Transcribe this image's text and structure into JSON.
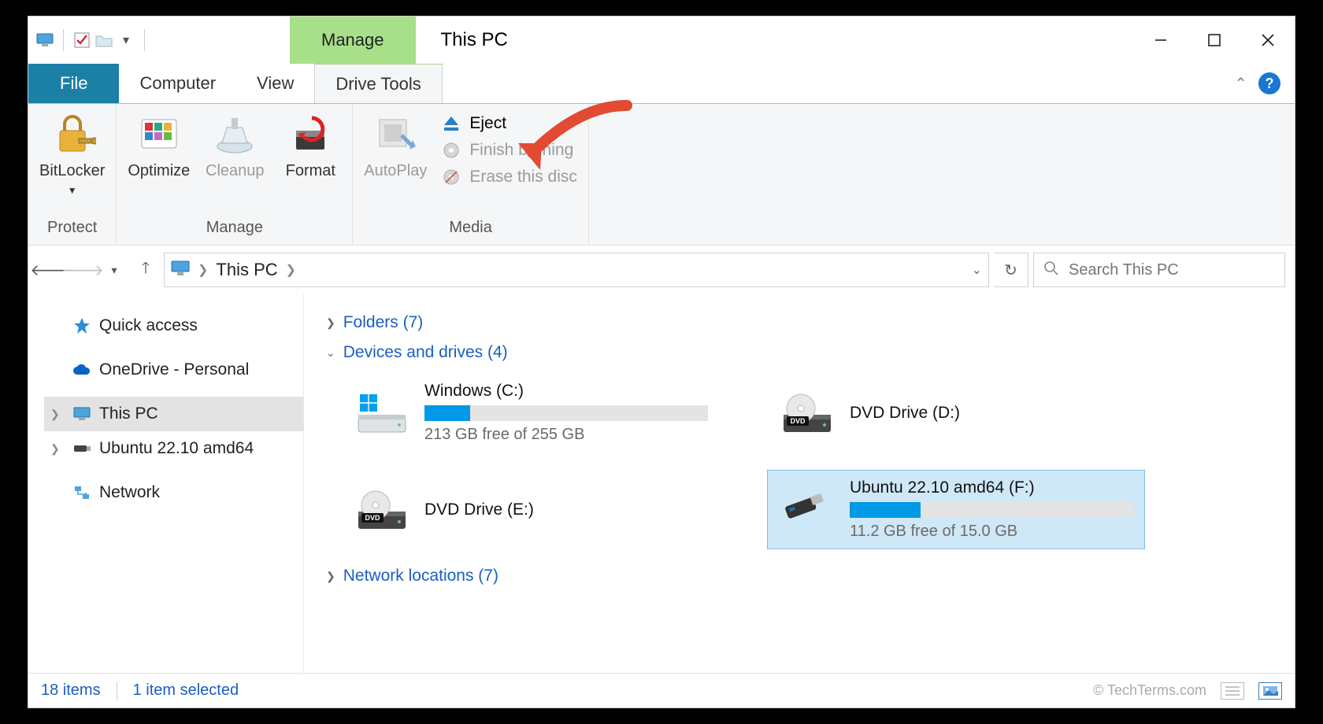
{
  "title": "This PC",
  "context_tab": "Manage",
  "tabs": {
    "file": "File",
    "computer": "Computer",
    "view": "View",
    "drive_tools": "Drive Tools"
  },
  "ribbon": {
    "protect": {
      "bitlocker": "BitLocker",
      "group_label": "Protect"
    },
    "manage": {
      "optimize": "Optimize",
      "cleanup": "Cleanup",
      "format": "Format",
      "group_label": "Manage"
    },
    "media": {
      "autoplay": "AutoPlay",
      "eject": "Eject",
      "finish_burning": "Finish burning",
      "erase_disc": "Erase this disc",
      "group_label": "Media"
    }
  },
  "address": {
    "location": "This PC"
  },
  "search": {
    "placeholder": "Search This PC"
  },
  "navpane": {
    "quick_access": "Quick access",
    "onedrive": "OneDrive - Personal",
    "this_pc": "This PC",
    "ubuntu": "Ubuntu 22.10 amd64",
    "network": "Network"
  },
  "sections": {
    "folders": "Folders (7)",
    "devices": "Devices and drives (4)",
    "network_locations": "Network locations (7)"
  },
  "drives": {
    "c": {
      "name": "Windows (C:)",
      "sub": "213 GB free of 255 GB",
      "fill_pct": 16
    },
    "d": {
      "name": "DVD Drive (D:)"
    },
    "e": {
      "name": "DVD Drive (E:)"
    },
    "f": {
      "name": "Ubuntu 22.10 amd64 (F:)",
      "sub": "11.2 GB free of 15.0 GB",
      "fill_pct": 25
    }
  },
  "status": {
    "items": "18 items",
    "selected": "1 item selected",
    "credits": "© TechTerms.com"
  }
}
